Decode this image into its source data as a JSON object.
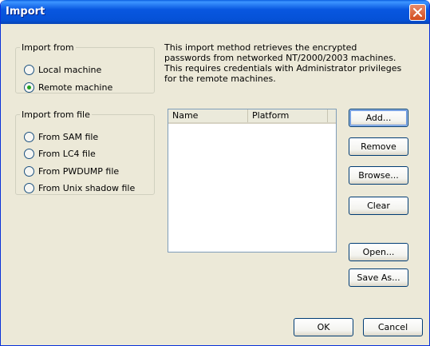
{
  "window": {
    "title": "Import"
  },
  "import_from": {
    "legend": "Import from",
    "options": [
      {
        "label": "Local machine",
        "checked": false
      },
      {
        "label": "Remote machine",
        "checked": true
      }
    ]
  },
  "import_from_file": {
    "legend": "Import from file",
    "options": [
      {
        "label": "From SAM file",
        "checked": false
      },
      {
        "label": "From LC4 file",
        "checked": false
      },
      {
        "label": "From PWDUMP file",
        "checked": false
      },
      {
        "label": "From Unix shadow file",
        "checked": false
      }
    ]
  },
  "description": [
    "This import method retrieves the encrypted",
    "passwords from networked NT/2000/2003 machines.",
    "This requires credentials with Administrator privileges",
    "for the remote machines."
  ],
  "machine_list": {
    "columns": [
      "Name",
      "Platform"
    ],
    "rows": []
  },
  "buttons": {
    "add": "Add...",
    "remove": "Remove",
    "browse": "Browse...",
    "clear": "Clear",
    "open": "Open...",
    "save_as": "Save As...",
    "ok": "OK",
    "cancel": "Cancel"
  },
  "colors": {
    "title_bar": "#0554d7",
    "dialog_bg": "#ece9d8",
    "close_button": "#d9542a"
  }
}
